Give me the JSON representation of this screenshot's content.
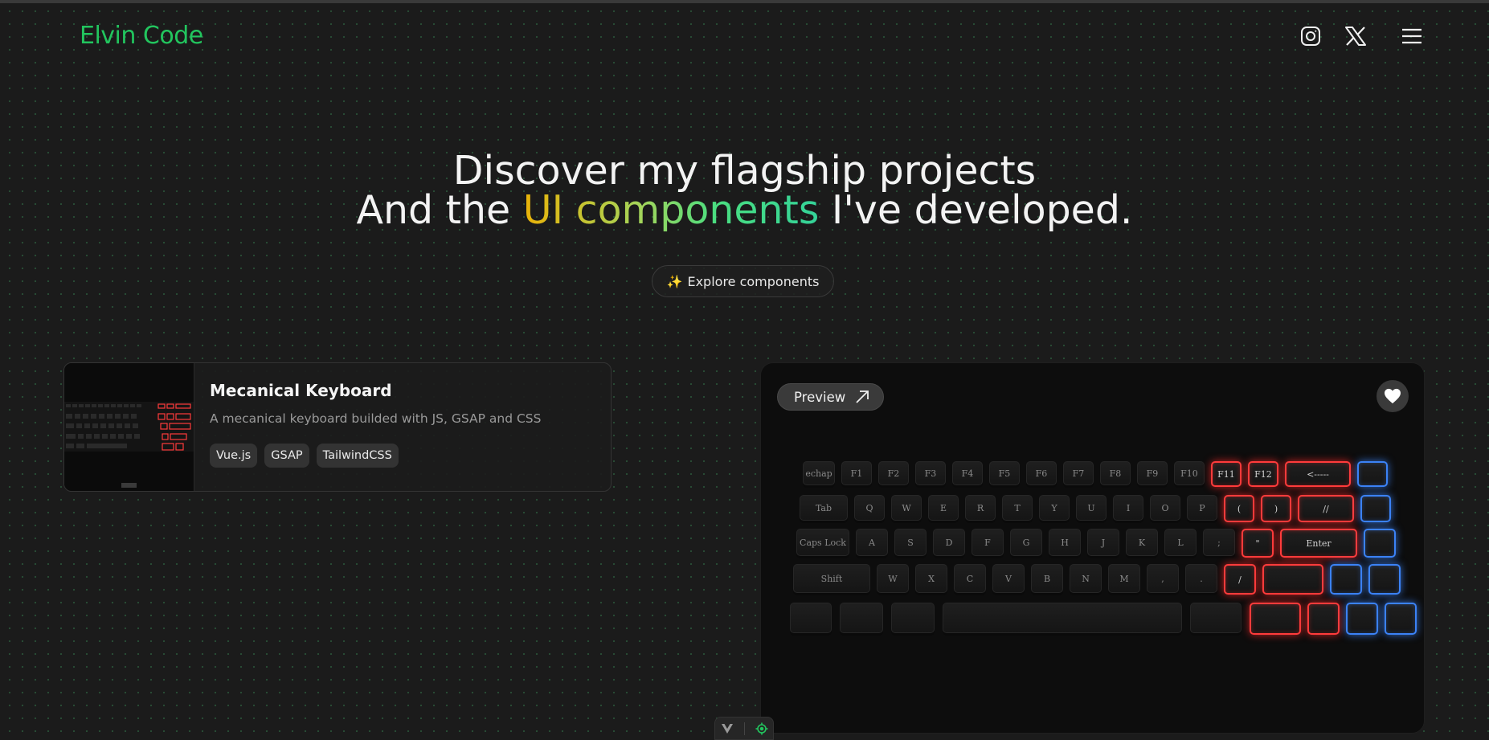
{
  "header": {
    "logo": "Elvin Code",
    "icons": [
      "instagram-icon",
      "x-twitter-icon",
      "menu-icon"
    ]
  },
  "hero": {
    "line1": "Discover my flagship projects",
    "line2_before": "And the ",
    "line2_highlight": "UI components",
    "line2_after": " I've developed."
  },
  "explore_button": {
    "emoji": "✨",
    "label": "Explore components"
  },
  "project": {
    "title": "Mecanical Keyboard",
    "description": "A mecanical keyboard builded with JS, GSAP and CSS",
    "tags": [
      "Vue.js",
      "GSAP",
      "TailwindCSS"
    ]
  },
  "preview": {
    "button_label": "Preview",
    "keyboard": {
      "row1": [
        "echap",
        "F1",
        "F2",
        "F3",
        "F4",
        "F5",
        "F6",
        "F7",
        "F8",
        "F9",
        "F10",
        "F11",
        "F12",
        "<-----",
        ""
      ],
      "row2": [
        "Tab",
        "Q",
        "W",
        "E",
        "R",
        "T",
        "Y",
        "U",
        "I",
        "O",
        "P",
        "(",
        ")",
        "//",
        ""
      ],
      "row3": [
        "Caps Lock",
        "A",
        "S",
        "D",
        "F",
        "G",
        "H",
        "J",
        "K",
        "L",
        ";",
        "\"",
        "Enter",
        ""
      ],
      "row4": [
        "Shift",
        "W",
        "X",
        "C",
        "V",
        "B",
        "N",
        "M",
        ",",
        ".",
        "/",
        "",
        "",
        ""
      ],
      "row5": [
        "",
        "",
        "",
        "",
        "",
        "",
        "",
        "",
        ""
      ]
    }
  },
  "colors": {
    "accent": "#22c55e",
    "key_red": "#ff3b3b",
    "key_blue": "#3b82f6"
  }
}
